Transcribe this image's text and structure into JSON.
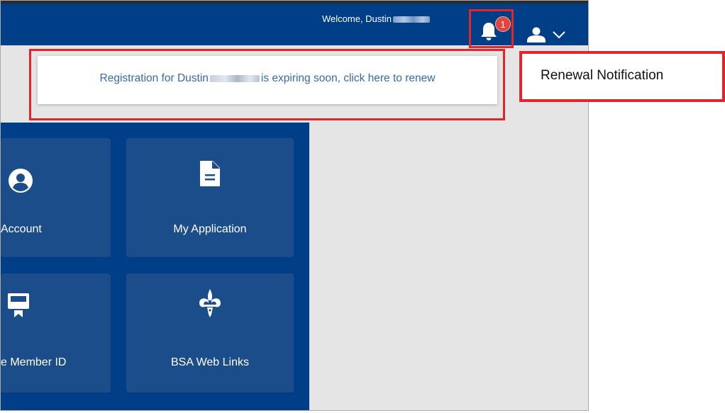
{
  "header": {
    "welcome_text": "Welcome, Dustin",
    "notification_count": "1"
  },
  "notification": {
    "text_before": "Registration for Dustin",
    "text_after": "is expiring soon, click here to renew"
  },
  "tiles": [
    {
      "label": "Account",
      "icon": "person-circle-icon"
    },
    {
      "label": "My Application",
      "icon": "document-icon"
    },
    {
      "label": "e Member ID",
      "icon": "member-card-icon"
    },
    {
      "label": "BSA Web Links",
      "icon": "bsa-fleur-de-lis-icon"
    }
  ],
  "callout": {
    "label": "Renewal Notification"
  },
  "colors": {
    "header_bg": "#003f87",
    "tile_bg": "#1c4d8b",
    "highlight_red": "#e4242b",
    "badge_red": "#e0453e",
    "notification_text": "#376aa7"
  }
}
